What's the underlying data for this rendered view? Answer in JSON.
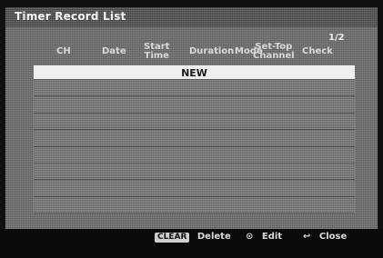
{
  "window": {
    "title": "Timer Record List",
    "page_indicator": "1/2"
  },
  "columns": {
    "ch": "CH",
    "date": "Date",
    "start_time_line1": "Start",
    "start_time_line2": "Time",
    "duration": "Duration",
    "mode": "Mode",
    "settop_line1": "Set-Top",
    "settop_line2": "Channel",
    "check": "Check"
  },
  "list": {
    "selected_item": "NEW",
    "row_count_visible": 9
  },
  "footer": {
    "clear_key": "CLEAR",
    "delete_label": "Delete",
    "edit_icon": "enter-circle-icon",
    "edit_label": "Edit",
    "close_icon": "return-arrow-icon",
    "close_label": "Close"
  },
  "colors": {
    "panel": "#6d6d6d",
    "titlebar": "#4c4c4c",
    "selected_row": "#efefef",
    "background": "#0b0b0b"
  }
}
